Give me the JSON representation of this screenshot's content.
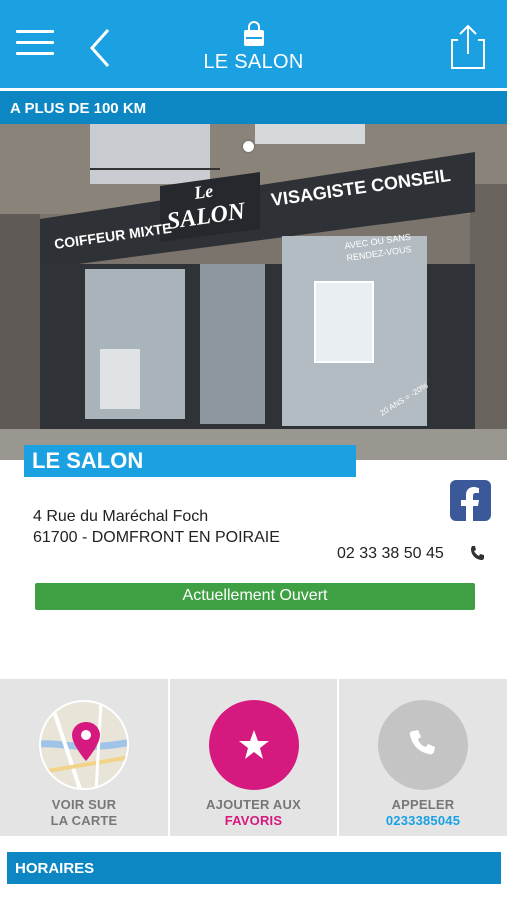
{
  "header": {
    "title": "LE SALON",
    "menu_icon": "hamburger-icon",
    "back_icon": "chevron-left-icon",
    "bag_icon": "shopping-bag-icon",
    "share_icon": "share-icon",
    "bg_color": "#1ba1e2"
  },
  "distance": {
    "label": "A PLUS DE 100 KM"
  },
  "hero": {
    "sign_left": "COIFFEUR MIXTE",
    "sign_logo_top": "Le",
    "sign_logo_bottom": "SALON",
    "sign_right": "VISAGISTE CONSEIL",
    "window_text_1": "AVEC OU SANS",
    "window_text_2": "RENDEZ-VOUS",
    "window_text_3": "20 ANS = -20%",
    "carousel_active": 1
  },
  "business": {
    "name": "LE SALON",
    "address_line1": "4 Rue du Maréchal Foch",
    "address_line2": "61700 - DOMFRONT EN POIRAIE",
    "phone": "02 33 38 50 45",
    "status": "Actuellement Ouvert",
    "status_color": "#3ea043"
  },
  "actions": {
    "map": {
      "line1": "VOIR SUR",
      "line2": "LA CARTE",
      "icon": "map-pin-icon"
    },
    "favorite": {
      "line1": "AJOUTER AUX",
      "line2": "FAVORIS",
      "icon": "star-icon",
      "color": "#d6197e"
    },
    "call": {
      "line1": "APPELER",
      "line2": "0233385045",
      "icon": "phone-icon"
    }
  },
  "sections": {
    "hours": "HORAIRES"
  }
}
